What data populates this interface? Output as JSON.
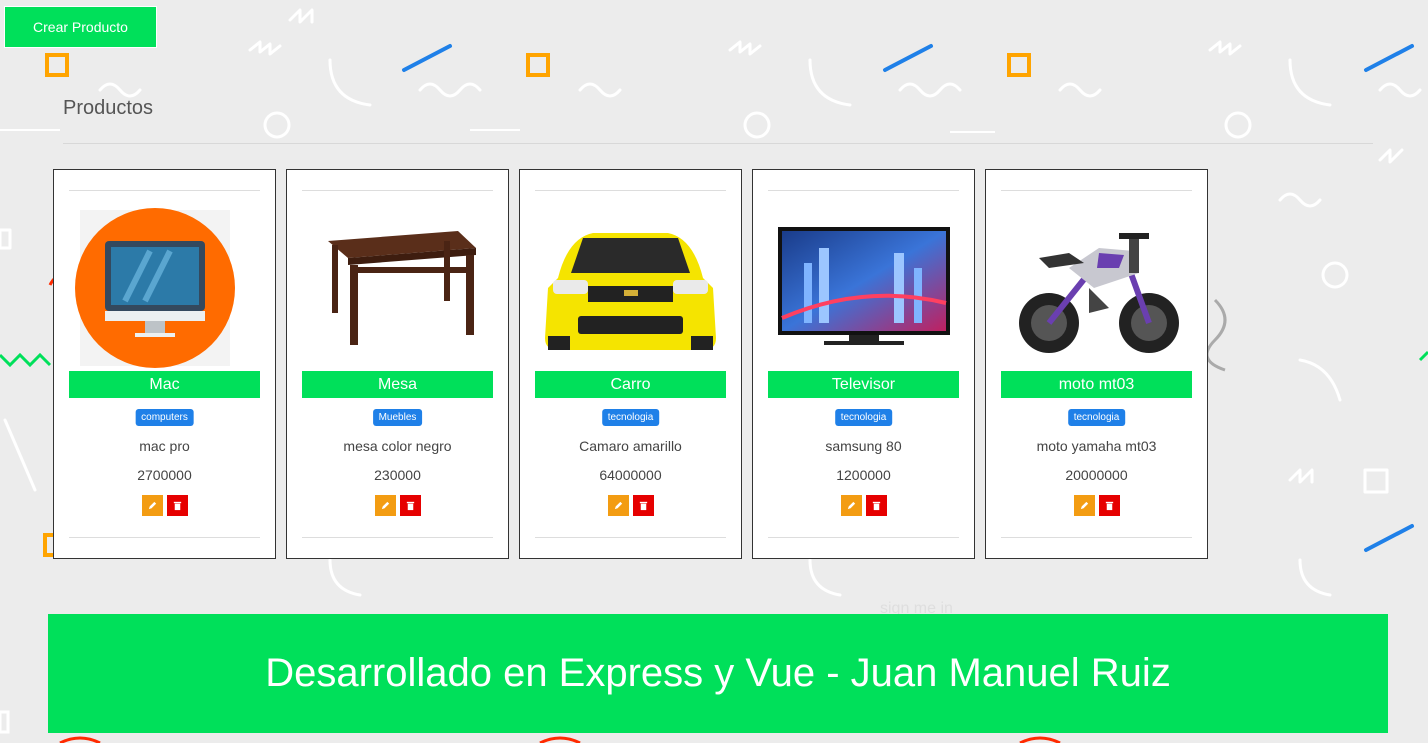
{
  "header": {
    "create_button": "Crear Producto",
    "title": "Productos"
  },
  "products": [
    {
      "name": "Mac",
      "category": "computers",
      "description": "mac pro",
      "price": "2700000",
      "image_icon": "imac-icon"
    },
    {
      "name": "Mesa",
      "category": "Muebles",
      "description": "mesa color negro",
      "price": "230000",
      "image_icon": "table-icon"
    },
    {
      "name": "Carro",
      "category": "tecnologia",
      "description": "Camaro amarillo",
      "price": "64000000",
      "image_icon": "car-icon"
    },
    {
      "name": "Televisor",
      "category": "tecnologia",
      "description": "samsung 80",
      "price": "1200000",
      "image_icon": "tv-icon"
    },
    {
      "name": "moto mt03",
      "category": "tecnologia",
      "description": "moto yamaha mt03",
      "price": "20000000",
      "image_icon": "motorcycle-icon"
    }
  ],
  "actions": {
    "edit_icon": "pencil-icon",
    "delete_icon": "trash-icon"
  },
  "background_text": "sign me in",
  "footer": {
    "text": "Desarrollado en Express y Vue - Juan Manuel Ruiz"
  },
  "colors": {
    "accent_green": "#00e05a",
    "badge_blue": "#1f80e8",
    "edit_orange": "#f39c12",
    "delete_red": "#e60000",
    "background": "#ececec"
  }
}
